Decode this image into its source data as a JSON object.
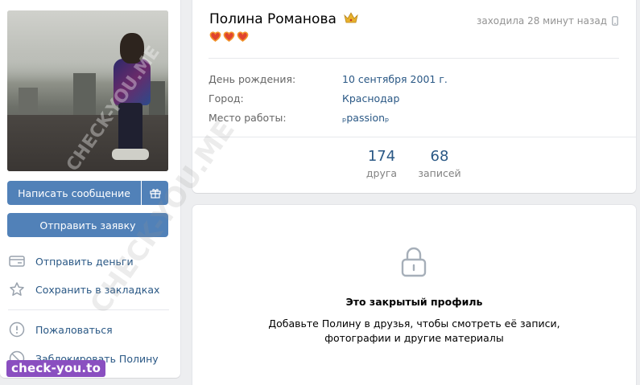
{
  "profile": {
    "name": "Полина Романова",
    "status_emoji": "❤❤❤",
    "last_seen": "заходила 28 минут назад"
  },
  "info": [
    {
      "key": "День рождения:",
      "value": "10 сентября 2001 г."
    },
    {
      "key": "Город:",
      "value": "Краснодар"
    },
    {
      "key": "Место работы:",
      "value": "ₚpassionₚ"
    }
  ],
  "counters": [
    {
      "num": "174",
      "label": "друга"
    },
    {
      "num": "68",
      "label": "записей"
    }
  ],
  "buttons": {
    "message": "Написать сообщение",
    "request": "Отправить заявку"
  },
  "actions": {
    "send_money": "Отправить деньги",
    "bookmark": "Сохранить в закладках",
    "report": "Пожаловаться",
    "block": "Заблокировать Полину"
  },
  "closed": {
    "title": "Это закрытый профиль",
    "line1": "Добавьте Полину в друзья, чтобы смотреть её записи,",
    "line2": "фотографии и другие материалы"
  },
  "watermark": {
    "stamp": "check-you.to",
    "text1": "CHECK-YOU.ME",
    "text2": "CHECK-YOU.ME"
  },
  "colors": {
    "accent": "#5181b8",
    "link": "#2a5885",
    "stamp": "#8a4fc0"
  }
}
